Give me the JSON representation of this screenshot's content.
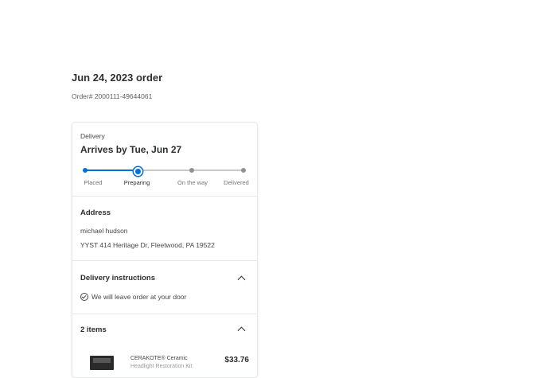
{
  "order": {
    "date": "Jun 24, 2023 order",
    "number": "Order# 2000111-49644061"
  },
  "delivery": {
    "label": "Delivery",
    "arrives": "Arrives by Tue, Jun 27",
    "steps": [
      "Placed",
      "Preparing",
      "On the way",
      "Delivered"
    ],
    "current_step": "Preparing",
    "accent_color": "#0071dc"
  },
  "address": {
    "title": "Address",
    "name": "michael hudson",
    "line": "YYST 414 Heritage Dr, Fleetwood, PA 19522"
  },
  "instructions": {
    "title": "Delivery instructions",
    "text": "We will leave order at your door",
    "expanded": true
  },
  "items": {
    "title": "2 items",
    "expanded": true,
    "list": [
      {
        "name_line1": "CERAKOTE® Ceramic",
        "name_line2": "Headlight Restoration Kit",
        "price": "$33.76"
      }
    ]
  }
}
